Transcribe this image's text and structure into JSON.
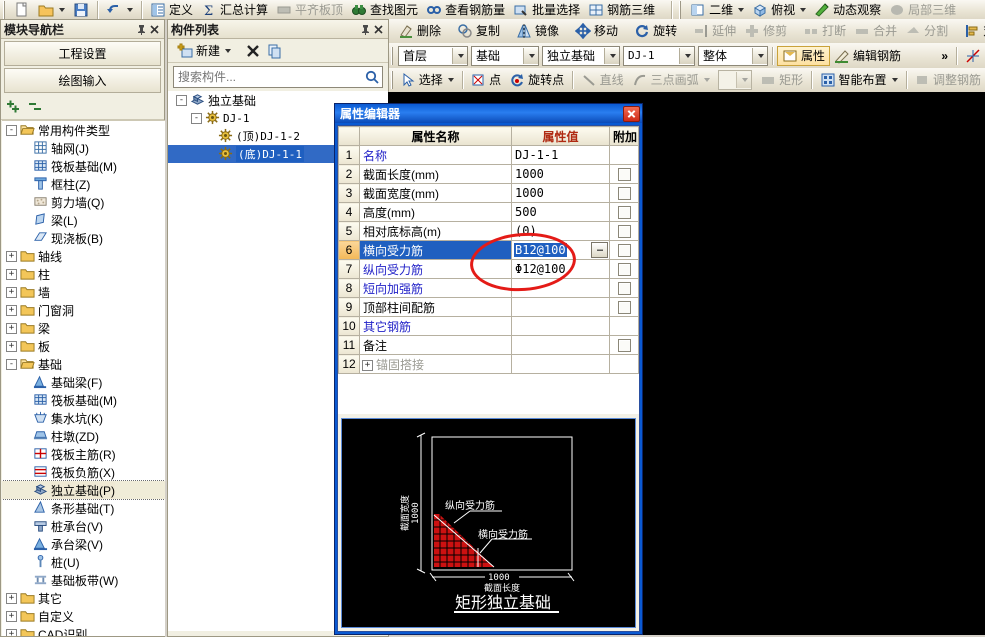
{
  "app": {
    "main_toolbar_left": [
      {
        "name": "new-file",
        "label": "",
        "icon": "page-icon"
      },
      {
        "name": "open-file",
        "label": "",
        "icon": "folder-icon",
        "caret": true
      },
      {
        "name": "save-file",
        "label": "",
        "icon": "floppy-icon"
      },
      {
        "name": "undo",
        "label": "",
        "icon": "undo-icon",
        "caret": true
      }
    ],
    "main_toolbar_items": [
      {
        "name": "define",
        "label": "定义",
        "icon": "define-icon",
        "disabled": false
      },
      {
        "name": "summary-calc",
        "label": "汇总计算",
        "icon": "sigma-icon",
        "disabled": false
      },
      {
        "name": "level-top",
        "label": "平齐板顶",
        "icon": "level-icon",
        "disabled": true
      },
      {
        "name": "find-element",
        "label": "查找图元",
        "icon": "binoculars-icon",
        "disabled": false
      },
      {
        "name": "view-rebar-qty",
        "label": "查看钢筋量",
        "icon": "rebar-qty-icon",
        "disabled": false
      },
      {
        "name": "batch-select",
        "label": "批量选择",
        "icon": "batch-icon",
        "disabled": false
      },
      {
        "name": "rebar-3d",
        "label": "钢筋三维",
        "icon": "rebar3d-icon",
        "disabled": false
      }
    ],
    "view_toolbar_items": [
      {
        "name": "two-d",
        "label": "二维",
        "icon": "2d-icon",
        "caret": true,
        "disabled": false
      },
      {
        "name": "top-view",
        "label": "俯视",
        "icon": "topview-icon",
        "caret": true,
        "disabled": false
      },
      {
        "name": "dynamic-observe",
        "label": "动态观察",
        "icon": "dynamic-icon",
        "disabled": false
      },
      {
        "name": "local-3d",
        "label": "局部三维",
        "icon": "local3d-icon",
        "disabled": true
      }
    ],
    "edit_toolbar_items": [
      {
        "name": "delete",
        "label": "删除",
        "icon": "eraser-icon",
        "disabled": false
      },
      {
        "name": "copy",
        "label": "复制",
        "icon": "copy-icon",
        "disabled": false
      },
      {
        "name": "mirror",
        "label": "镜像",
        "icon": "mirror-icon",
        "disabled": false
      },
      {
        "name": "move",
        "label": "移动",
        "icon": "move-icon",
        "disabled": false
      },
      {
        "name": "rotate",
        "label": "旋转",
        "icon": "rotate-icon",
        "disabled": false
      },
      {
        "name": "extend",
        "label": "延伸",
        "icon": "extend-icon",
        "disabled": true
      },
      {
        "name": "trim",
        "label": "修剪",
        "icon": "trim-icon",
        "disabled": true
      },
      {
        "name": "break",
        "label": "打断",
        "icon": "break-icon",
        "disabled": true
      },
      {
        "name": "merge",
        "label": "合并",
        "icon": "merge-icon",
        "disabled": true
      },
      {
        "name": "split",
        "label": "分割",
        "icon": "split-icon",
        "disabled": true
      },
      {
        "name": "align",
        "label": "对齐",
        "icon": "align-icon",
        "disabled": false
      }
    ],
    "context_bar": {
      "selects": [
        {
          "name": "floor-select",
          "value": "首层"
        },
        {
          "name": "category-select",
          "value": "基础"
        },
        {
          "name": "component-type-select",
          "value": "独立基础"
        },
        {
          "name": "component-select",
          "value": "DJ-1"
        },
        {
          "name": "whole-select",
          "value": "整体"
        }
      ],
      "buttons": [
        {
          "name": "properties-button",
          "label": "属性",
          "icon": "properties-icon"
        },
        {
          "name": "edit-rebar-button",
          "label": "编辑钢筋",
          "icon": "edit-rebar-icon"
        }
      ],
      "overflow_label": "»"
    },
    "draw_bar": {
      "items": [
        {
          "name": "select-tool",
          "label": "选择",
          "icon": "cursor-icon",
          "caret": true,
          "disabled": false
        },
        {
          "name": "point-tool",
          "label": "点",
          "icon": "point-icon",
          "disabled": false
        },
        {
          "name": "rotate-point-tool",
          "label": "旋转点",
          "icon": "rotate-point-icon",
          "disabled": false
        },
        {
          "name": "line-tool",
          "label": "直线",
          "icon": "line-icon",
          "disabled": true
        },
        {
          "name": "three-point-arc-tool",
          "label": "三点画弧",
          "icon": "arc-icon",
          "caret": true,
          "disabled": true
        },
        {
          "name": "rect-tool",
          "label": "矩形",
          "icon": "rect-icon",
          "disabled": true
        },
        {
          "name": "smart-layout-tool",
          "label": "智能布置",
          "icon": "smart-icon",
          "caret": true,
          "disabled": false
        },
        {
          "name": "adjust-rebar-tool",
          "label": "调整钢筋",
          "icon": "adjust-rebar-icon",
          "disabled": true
        }
      ],
      "empty_combo_value": ""
    }
  },
  "module_panel": {
    "title": "模块导航栏",
    "nav_buttons": [
      {
        "name": "project-settings",
        "label": "工程设置"
      },
      {
        "name": "drawing-input",
        "label": "绘图输入"
      }
    ],
    "tree": [
      {
        "label": "常用构件类型",
        "depth": 0,
        "icon": "folder-open-icon",
        "expander": "-"
      },
      {
        "label": "轴网(J)",
        "depth": 1,
        "icon": "grid-icon"
      },
      {
        "label": "筏板基础(M)",
        "depth": 1,
        "icon": "raft-icon"
      },
      {
        "label": "框柱(Z)",
        "depth": 1,
        "icon": "column-icon"
      },
      {
        "label": "剪力墙(Q)",
        "depth": 1,
        "icon": "shearwall-icon"
      },
      {
        "label": "梁(L)",
        "depth": 1,
        "icon": "beam-icon"
      },
      {
        "label": "现浇板(B)",
        "depth": 1,
        "icon": "slab-icon"
      },
      {
        "label": "轴线",
        "depth": 0,
        "icon": "folder-icon",
        "expander": "+"
      },
      {
        "label": "柱",
        "depth": 0,
        "icon": "folder-icon",
        "expander": "+"
      },
      {
        "label": "墙",
        "depth": 0,
        "icon": "folder-icon",
        "expander": "+"
      },
      {
        "label": "门窗洞",
        "depth": 0,
        "icon": "folder-icon",
        "expander": "+"
      },
      {
        "label": "梁",
        "depth": 0,
        "icon": "folder-icon",
        "expander": "+"
      },
      {
        "label": "板",
        "depth": 0,
        "icon": "folder-icon",
        "expander": "+"
      },
      {
        "label": "基础",
        "depth": 0,
        "icon": "folder-open-icon",
        "expander": "-"
      },
      {
        "label": "基础梁(F)",
        "depth": 1,
        "icon": "found-beam-icon"
      },
      {
        "label": "筏板基础(M)",
        "depth": 1,
        "icon": "raft-icon"
      },
      {
        "label": "集水坑(K)",
        "depth": 1,
        "icon": "sump-icon"
      },
      {
        "label": "柱墩(ZD)",
        "depth": 1,
        "icon": "pier-icon"
      },
      {
        "label": "筏板主筋(R)",
        "depth": 1,
        "icon": "main-rebar-icon"
      },
      {
        "label": "筏板负筋(X)",
        "depth": 1,
        "icon": "neg-rebar-icon"
      },
      {
        "label": "独立基础(P)",
        "depth": 1,
        "icon": "isolated-footing-icon",
        "selected": true
      },
      {
        "label": "条形基础(T)",
        "depth": 1,
        "icon": "strip-footing-icon"
      },
      {
        "label": "桩承台(V)",
        "depth": 1,
        "icon": "pile-cap-icon"
      },
      {
        "label": "承台梁(V)",
        "depth": 1,
        "icon": "cap-beam-icon"
      },
      {
        "label": "桩(U)",
        "depth": 1,
        "icon": "pile-icon"
      },
      {
        "label": "基础板带(W)",
        "depth": 1,
        "icon": "found-strip-icon"
      },
      {
        "label": "其它",
        "depth": 0,
        "icon": "folder-icon",
        "expander": "+"
      },
      {
        "label": "自定义",
        "depth": 0,
        "icon": "folder-icon",
        "expander": "+"
      },
      {
        "label": "CAD识别",
        "depth": 0,
        "icon": "folder-icon",
        "expander": "+"
      }
    ]
  },
  "component_panel": {
    "title": "构件列表",
    "buttons": [
      {
        "name": "new-component-button",
        "label": "新建",
        "icon": "new-icon",
        "caret": true
      },
      {
        "name": "delete-component-button",
        "label": "",
        "icon": "delete-x-icon"
      },
      {
        "name": "copy-component-button",
        "label": "",
        "icon": "copy-doc-icon"
      }
    ],
    "search_placeholder": "搜索构件...",
    "search_value": "",
    "tree": [
      {
        "label": "独立基础",
        "depth": 0,
        "icon": "isolated-footing-icon",
        "expander": "-"
      },
      {
        "label": "DJ-1",
        "depth": 1,
        "icon": "gear-icon",
        "expander": "-"
      },
      {
        "label": "(顶)DJ-1-2",
        "depth": 2,
        "icon": "gear-icon"
      },
      {
        "label": "(底)DJ-1-1",
        "depth": 2,
        "icon": "gear-icon",
        "selected": true
      }
    ]
  },
  "dialog": {
    "title": "属性编辑器",
    "close_label": "×",
    "headers": {
      "index": "",
      "name": "属性名称",
      "value": "属性值",
      "extra": "附加"
    },
    "rows": [
      {
        "n": "1",
        "name": "名称",
        "name_blue": true,
        "value": "DJ-1-1",
        "chk": false
      },
      {
        "n": "2",
        "name": "截面长度(mm)",
        "name_blue": false,
        "value": "1000",
        "chk": true
      },
      {
        "n": "3",
        "name": "截面宽度(mm)",
        "name_blue": false,
        "value": "1000",
        "chk": true
      },
      {
        "n": "4",
        "name": "高度(mm)",
        "name_blue": false,
        "value": "500",
        "chk": true
      },
      {
        "n": "5",
        "name": "相对底标高(m)",
        "name_blue": false,
        "value": "(0)",
        "chk": true
      },
      {
        "n": "6",
        "name": "横向受力筋",
        "name_blue": true,
        "value": "B12@100",
        "chk": true,
        "selected": true,
        "editing": true,
        "has_ellipsis": true
      },
      {
        "n": "7",
        "name": "纵向受力筋",
        "name_blue": true,
        "value": "Φ12@100",
        "chk": true
      },
      {
        "n": "8",
        "name": "短向加强筋",
        "name_blue": true,
        "value": "",
        "chk": true
      },
      {
        "n": "9",
        "name": "顶部柱间配筋",
        "name_blue": false,
        "value": "",
        "chk": true
      },
      {
        "n": "10",
        "name": "其它钢筋",
        "name_blue": true,
        "value": "",
        "chk": false
      },
      {
        "n": "11",
        "name": "备注",
        "name_blue": false,
        "value": "",
        "chk": true
      },
      {
        "n": "12",
        "name": "锚固搭接",
        "name_blue": false,
        "value": "",
        "chk": false,
        "expander": "+",
        "gray": true
      }
    ],
    "preview": {
      "caption": "矩形独立基础",
      "dim_bottom": "1000",
      "dim_bottom_label": "截面长度",
      "dim_left": "1000",
      "dim_left_label": "截面宽度",
      "leader_top": "纵向受力筋",
      "leader_bottom": "横向受力筋"
    },
    "annotation": {
      "shape": "ellipse",
      "color": "#e41b17"
    }
  },
  "colors": {
    "dialog_title": "#0a5ad2",
    "value_header": "#f6c479",
    "selection": "#316ac5",
    "annotation_red": "#e41b17",
    "model_green": "#aeb763",
    "axis_red": "#aa0000",
    "axis_green": "#00aa00"
  }
}
